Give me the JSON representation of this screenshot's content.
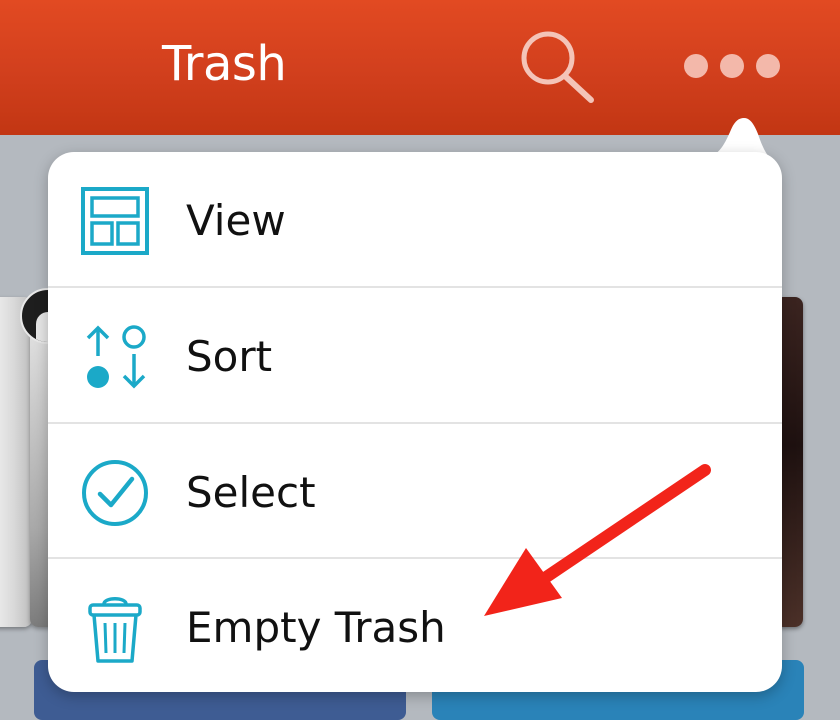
{
  "header": {
    "title": "Trash",
    "search_icon": "search-icon",
    "more_icon": "more-horizontal-icon",
    "background_color": "#d64220"
  },
  "menu": {
    "items": [
      {
        "label": "View",
        "icon": "view-layout-icon"
      },
      {
        "label": "Sort",
        "icon": "sort-icon"
      },
      {
        "label": "Select",
        "icon": "checkmark-circle-icon"
      },
      {
        "label": "Empty Trash",
        "icon": "trash-icon"
      }
    ],
    "icon_color": "#1ba9c8"
  },
  "annotation": {
    "icon": "red-arrow-icon",
    "color": "#f2241a"
  }
}
